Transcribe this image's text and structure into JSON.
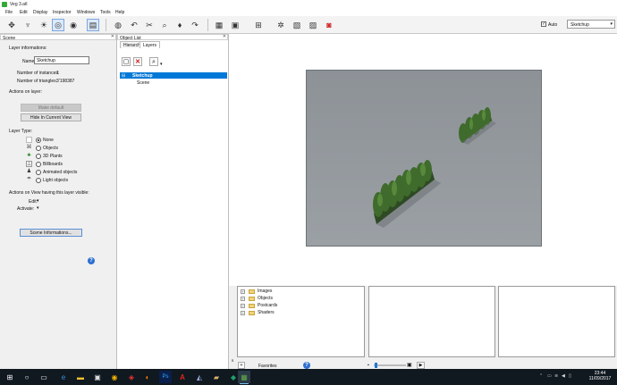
{
  "window": {
    "title": "Veg 3.atl"
  },
  "menu": [
    "File",
    "Edit",
    "Display",
    "Inspector",
    "Windows",
    "Tools",
    "Help"
  ],
  "toolbar": {
    "auto_label": "Auto",
    "auto_checked": true,
    "layer_select_value": "Sketchup",
    "icons": [
      "pointer-icon",
      "light-icon",
      "sun-icon",
      "camera-icon",
      "camera-settings-icon",
      "layers-icon",
      "sphere-icon",
      "undo-icon",
      "lasso-icon",
      "zoom-icon",
      "bulb-icon",
      "redo-icon",
      "layout-icon",
      "window-icon",
      "grid-icon",
      "gear-icon",
      "image-icon",
      "render-icon"
    ]
  },
  "scene_panel": {
    "title": "Scene",
    "layer_informations": "Layer informations:",
    "name_label": "Name:",
    "name_value": "Sketchup",
    "instances_label": "Number of instances:",
    "instances_value": "1",
    "triangles_label": "Number of triangles:",
    "triangles_value": "3'198387",
    "actions_label": "Actions on layer:",
    "make_default": "Make default",
    "hide_in_view": "Hide In Current View",
    "layer_type_label": "Layer Type:",
    "layer_types": [
      "None",
      "Objects",
      "3D Plants",
      "Billboards",
      "Animated objects",
      "Light objects"
    ],
    "layer_type_selected": "None",
    "actions_view_label": "Actions on View having this layer visible:",
    "edit_label": "Edit:",
    "activate_label": "Activate:",
    "scene_info_button": "Scene Informations...",
    "help": "?"
  },
  "object_list": {
    "title": "Object List",
    "tabs": [
      "Hierarchy",
      "Layers"
    ],
    "active_tab": "Layers",
    "layers": [
      {
        "label": "Sketchup",
        "selected": true
      },
      {
        "label": "Scene",
        "selected": false
      }
    ]
  },
  "browser": {
    "tree": [
      "Images",
      "Objects",
      "Postcards",
      "Shaders"
    ],
    "favorites_label": "Favorites",
    "side_tab": "atalog",
    "help": "?"
  },
  "taskbar": {
    "time": "23:44",
    "date": "11/09/2017",
    "apps": [
      "windows-start-icon",
      "search-icon",
      "task-view-icon",
      "edge-icon",
      "file-explorer-icon",
      "store-icon",
      "chrome-icon",
      "app-red-icon",
      "firefox-icon",
      "photoshop-icon",
      "acrobat-icon",
      "app-blue-icon",
      "app-folder-icon",
      "app-green-icon",
      "app-active-icon"
    ]
  },
  "colors": {
    "accent": "#0078d7",
    "render_bg": "#8f9499",
    "taskbar": "#101820"
  }
}
